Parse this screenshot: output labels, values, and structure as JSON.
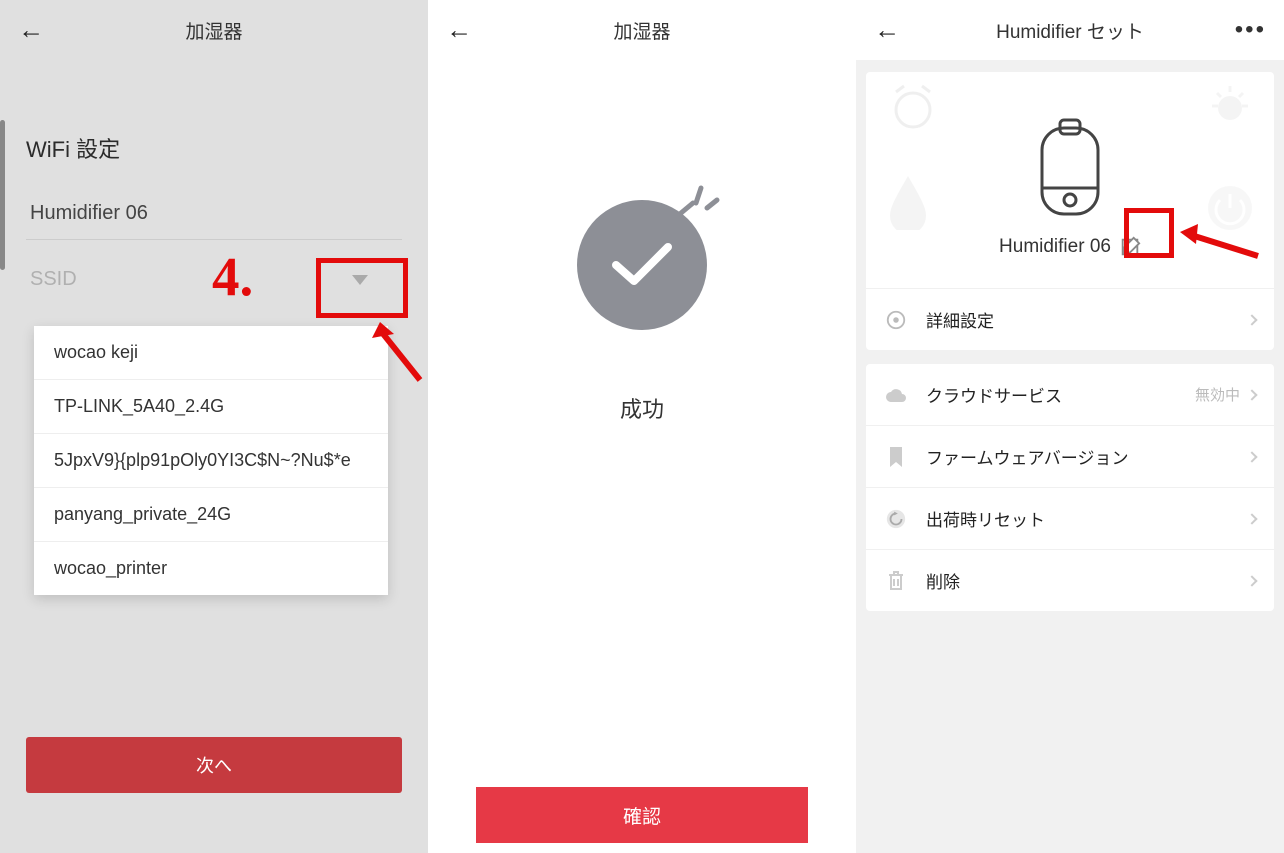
{
  "screen1": {
    "header_title": "加湿器",
    "section_title": "WiFi 設定",
    "device_name": "Humidifier 06",
    "ssid_label": "SSID",
    "ssid_options": [
      "wocao keji",
      "TP-LINK_5A40_2.4G",
      "5JpxV9}{plp91pOly0YI3C$N~?Nu$*e",
      "panyang_private_24G",
      "wocao_printer"
    ],
    "next_button": "次へ",
    "annotation_4": "4."
  },
  "screen2": {
    "header_title": "加湿器",
    "success_text": "成功",
    "confirm_button": "確認"
  },
  "screen3": {
    "header_title": "Humidifier セット",
    "device_name": "Humidifier 06",
    "menu": {
      "advanced": "詳細設定",
      "cloud": "クラウドサービス",
      "cloud_status": "無効中",
      "firmware": "ファームウェアバージョン",
      "reset": "出荷時リセット",
      "delete": "削除"
    }
  }
}
